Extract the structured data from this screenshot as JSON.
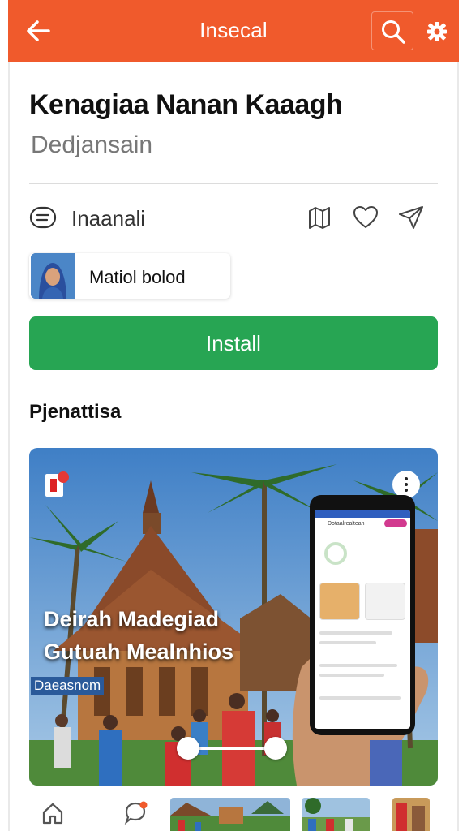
{
  "header": {
    "title": "Insecal",
    "back_icon": "back-arrow-icon",
    "search_icon": "search-icon",
    "settings_icon": "gear-icon",
    "background": "#f05a2c"
  },
  "app": {
    "title": "Kenagiaa Nanan Kaaagh",
    "subtitle": "Dedjansain",
    "category": "Inaanali",
    "developer": "Matiol bolod",
    "install_label": "Install",
    "install_color": "#27a553"
  },
  "section": {
    "title": "Pjenattisa"
  },
  "banner": {
    "headline1": "Deirah Madegiad",
    "headline2": "Gutuah Mealnhios",
    "sign": "Daeasnom",
    "phone_header": "Dotaalrealtean"
  },
  "bottom_nav": {
    "items": [
      "home-icon",
      "chat-notification-icon",
      "thumbnail-1",
      "thumbnail-2",
      "thumbnail-3"
    ]
  }
}
